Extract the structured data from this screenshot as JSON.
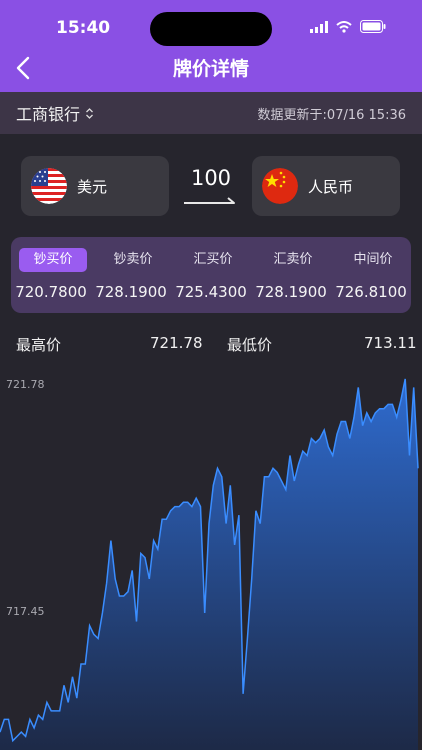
{
  "status": {
    "time": "15:40"
  },
  "nav": {
    "title": "牌价详情"
  },
  "bank_bar": {
    "bank_name": "工商银行",
    "updated": "数据更新于:07/16 15:36"
  },
  "converter": {
    "from_currency": "美元",
    "to_currency": "人民币",
    "amount": "100"
  },
  "rates": {
    "tabs": [
      {
        "label": "钞买价",
        "value": "720.7800"
      },
      {
        "label": "钞卖价",
        "value": "728.1900"
      },
      {
        "label": "汇买价",
        "value": "725.4300"
      },
      {
        "label": "汇卖价",
        "value": "728.1900"
      },
      {
        "label": "中间价",
        "value": "726.8100"
      }
    ],
    "active_index": 0
  },
  "summary": {
    "high_label": "最高价",
    "high_value": "721.78",
    "low_label": "最低价",
    "low_value": "713.11"
  },
  "colors": {
    "accent": "#8a50e4",
    "line": "#3a8dff"
  },
  "chart_data": {
    "type": "area",
    "title": "",
    "xlabel": "",
    "ylabel": "",
    "ytick_labels": [
      "721.78",
      "717.45"
    ],
    "ylim": [
      713.11,
      721.78
    ],
    "grid": false,
    "series": [
      {
        "values": [
          713.6,
          713.9,
          713.9,
          713.4,
          713.5,
          713.6,
          713.5,
          713.9,
          713.7,
          714.0,
          713.9,
          714.3,
          714.1,
          714.1,
          714.1,
          714.7,
          714.3,
          714.9,
          714.4,
          715.2,
          715.2,
          716.1,
          715.9,
          715.8,
          716.4,
          717.1,
          718.1,
          717.2,
          716.8,
          716.8,
          716.9,
          717.4,
          716.2,
          717.8,
          717.7,
          717.2,
          718.1,
          717.9,
          718.6,
          718.6,
          718.8,
          718.9,
          718.9,
          719.0,
          719.0,
          718.9,
          719.1,
          718.9,
          716.4,
          718.5,
          719.4,
          719.8,
          719.6,
          718.5,
          719.4,
          718.0,
          718.7,
          714.5,
          715.8,
          717.2,
          718.8,
          718.5,
          719.6,
          719.6,
          719.8,
          719.7,
          719.5,
          719.3,
          720.1,
          719.5,
          719.9,
          720.2,
          720.1,
          720.5,
          720.4,
          720.5,
          720.7,
          720.3,
          720.1,
          720.6,
          720.9,
          720.9,
          720.5,
          721.0,
          721.7,
          720.8,
          721.1,
          720.9,
          721.1,
          721.2,
          721.2,
          721.3,
          721.3,
          721.0,
          721.4,
          721.9,
          720.1,
          721.7,
          719.8
        ]
      }
    ]
  }
}
